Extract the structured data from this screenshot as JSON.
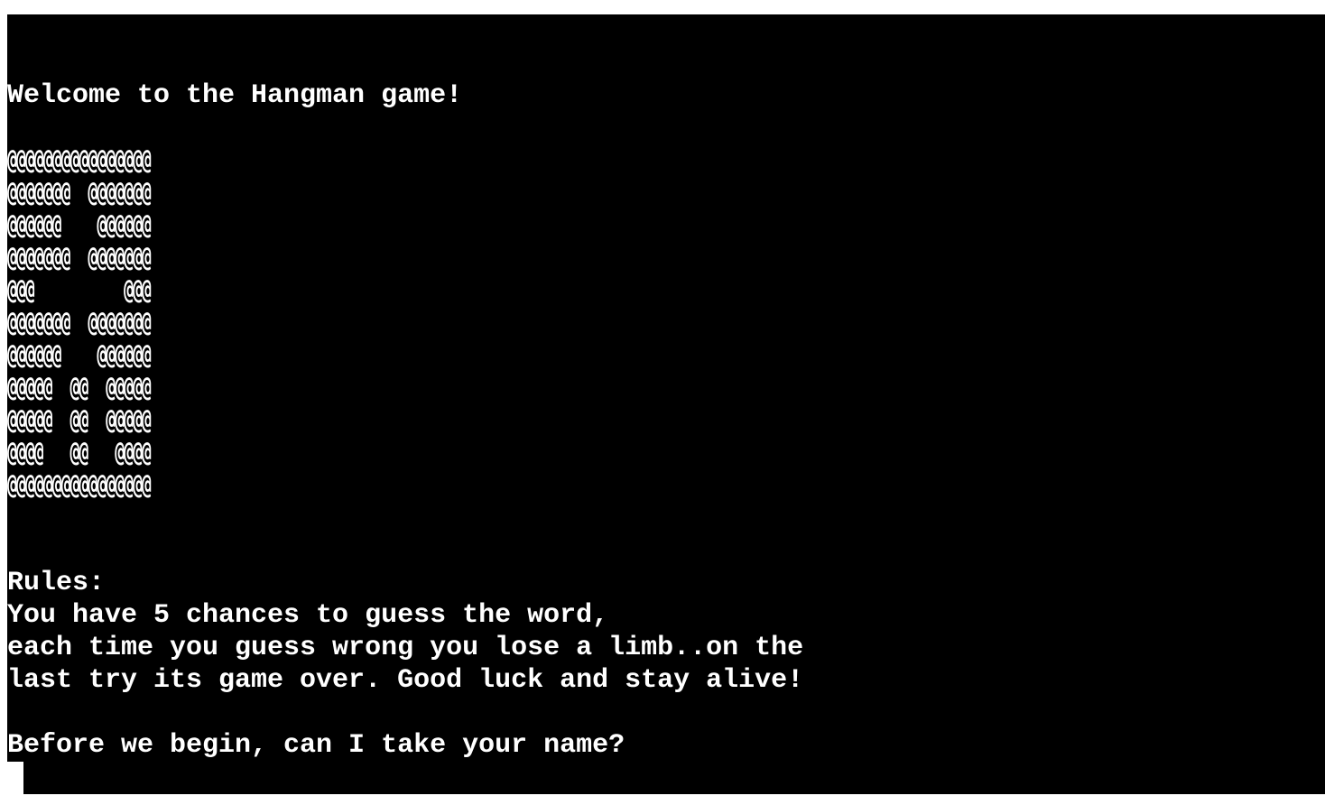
{
  "terminal": {
    "welcome": "Welcome to the Hangman game!",
    "art": [
      "@@@@@@@@@@@@@@@@",
      "@@@@@@@  @@@@@@@",
      "@@@@@@    @@@@@@",
      "@@@@@@@  @@@@@@@",
      "@@@          @@@",
      "@@@@@@@  @@@@@@@",
      "@@@@@@    @@@@@@",
      "@@@@@  @@  @@@@@",
      "@@@@@  @@  @@@@@",
      "@@@@   @@   @@@@",
      "@@@@@@@@@@@@@@@@"
    ],
    "rules_heading": "Rules:",
    "rules_lines": [
      "You have 5 chances to guess the word,",
      "each time you guess wrong you lose a limb..on the",
      "last try its game over. Good luck and stay alive!"
    ],
    "prompt": "Before we begin, can I take your name?",
    "colors": {
      "background": "#000000",
      "text": "#ffffff",
      "page": "#ffffff"
    }
  }
}
